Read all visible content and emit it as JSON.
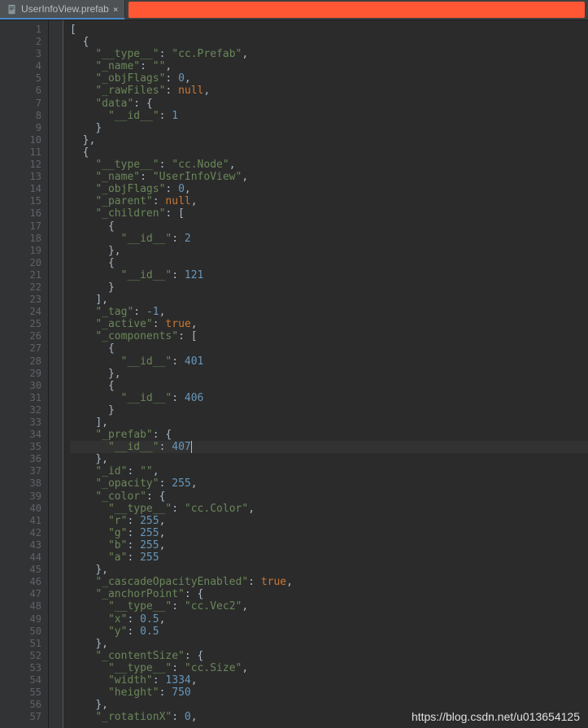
{
  "tab": {
    "filename": "UserInfoView.prefab",
    "close": "×"
  },
  "watermark": "https://blog.csdn.net/u013654125",
  "code": [
    {
      "n": 1,
      "t": "[",
      "i": 0
    },
    {
      "n": 2,
      "t": "{",
      "i": 1
    },
    {
      "n": 3,
      "i": 2,
      "tokens": [
        {
          "c": "s",
          "v": "\"__type__\""
        },
        {
          "c": "p",
          "v": ": "
        },
        {
          "c": "s",
          "v": "\"cc.Prefab\""
        },
        {
          "c": "p",
          "v": ","
        }
      ]
    },
    {
      "n": 4,
      "i": 2,
      "tokens": [
        {
          "c": "s",
          "v": "\"_name\""
        },
        {
          "c": "p",
          "v": ": "
        },
        {
          "c": "s",
          "v": "\"\""
        },
        {
          "c": "p",
          "v": ","
        }
      ]
    },
    {
      "n": 5,
      "i": 2,
      "tokens": [
        {
          "c": "s",
          "v": "\"_objFlags\""
        },
        {
          "c": "p",
          "v": ": "
        },
        {
          "c": "n",
          "v": "0"
        },
        {
          "c": "p",
          "v": ","
        }
      ]
    },
    {
      "n": 6,
      "i": 2,
      "tokens": [
        {
          "c": "s",
          "v": "\"_rawFiles\""
        },
        {
          "c": "p",
          "v": ": "
        },
        {
          "c": "b",
          "v": "null"
        },
        {
          "c": "p",
          "v": ","
        }
      ]
    },
    {
      "n": 7,
      "i": 2,
      "tokens": [
        {
          "c": "s",
          "v": "\"data\""
        },
        {
          "c": "p",
          "v": ": {"
        }
      ]
    },
    {
      "n": 8,
      "i": 3,
      "tokens": [
        {
          "c": "s",
          "v": "\"__id__\""
        },
        {
          "c": "p",
          "v": ": "
        },
        {
          "c": "n",
          "v": "1"
        }
      ]
    },
    {
      "n": 9,
      "t": "}",
      "i": 2
    },
    {
      "n": 10,
      "t": "},",
      "i": 1
    },
    {
      "n": 11,
      "t": "{",
      "i": 1
    },
    {
      "n": 12,
      "i": 2,
      "tokens": [
        {
          "c": "s",
          "v": "\"__type__\""
        },
        {
          "c": "p",
          "v": ": "
        },
        {
          "c": "s",
          "v": "\"cc.Node\""
        },
        {
          "c": "p",
          "v": ","
        }
      ]
    },
    {
      "n": 13,
      "i": 2,
      "tokens": [
        {
          "c": "s",
          "v": "\"_name\""
        },
        {
          "c": "p",
          "v": ": "
        },
        {
          "c": "s",
          "v": "\"UserInfoView\""
        },
        {
          "c": "p",
          "v": ","
        }
      ]
    },
    {
      "n": 14,
      "i": 2,
      "tokens": [
        {
          "c": "s",
          "v": "\"_objFlags\""
        },
        {
          "c": "p",
          "v": ": "
        },
        {
          "c": "n",
          "v": "0"
        },
        {
          "c": "p",
          "v": ","
        }
      ]
    },
    {
      "n": 15,
      "i": 2,
      "tokens": [
        {
          "c": "s",
          "v": "\"_parent\""
        },
        {
          "c": "p",
          "v": ": "
        },
        {
          "c": "b",
          "v": "null"
        },
        {
          "c": "p",
          "v": ","
        }
      ]
    },
    {
      "n": 16,
      "i": 2,
      "tokens": [
        {
          "c": "s",
          "v": "\"_children\""
        },
        {
          "c": "p",
          "v": ": ["
        }
      ]
    },
    {
      "n": 17,
      "t": "{",
      "i": 3
    },
    {
      "n": 18,
      "i": 4,
      "tokens": [
        {
          "c": "s",
          "v": "\"__id__\""
        },
        {
          "c": "p",
          "v": ": "
        },
        {
          "c": "n",
          "v": "2"
        }
      ]
    },
    {
      "n": 19,
      "t": "},",
      "i": 3
    },
    {
      "n": 20,
      "t": "{",
      "i": 3
    },
    {
      "n": 21,
      "i": 4,
      "tokens": [
        {
          "c": "s",
          "v": "\"__id__\""
        },
        {
          "c": "p",
          "v": ": "
        },
        {
          "c": "n",
          "v": "121"
        }
      ]
    },
    {
      "n": 22,
      "t": "}",
      "i": 3
    },
    {
      "n": 23,
      "t": "],",
      "i": 2
    },
    {
      "n": 24,
      "i": 2,
      "tokens": [
        {
          "c": "s",
          "v": "\"_tag\""
        },
        {
          "c": "p",
          "v": ": "
        },
        {
          "c": "n",
          "v": "-1"
        },
        {
          "c": "p",
          "v": ","
        }
      ]
    },
    {
      "n": 25,
      "i": 2,
      "tokens": [
        {
          "c": "s",
          "v": "\"_active\""
        },
        {
          "c": "p",
          "v": ": "
        },
        {
          "c": "b",
          "v": "true"
        },
        {
          "c": "p",
          "v": ","
        }
      ]
    },
    {
      "n": 26,
      "i": 2,
      "tokens": [
        {
          "c": "s",
          "v": "\"_components\""
        },
        {
          "c": "p",
          "v": ": ["
        }
      ]
    },
    {
      "n": 27,
      "t": "{",
      "i": 3
    },
    {
      "n": 28,
      "i": 4,
      "tokens": [
        {
          "c": "s",
          "v": "\"__id__\""
        },
        {
          "c": "p",
          "v": ": "
        },
        {
          "c": "n",
          "v": "401"
        }
      ]
    },
    {
      "n": 29,
      "t": "},",
      "i": 3
    },
    {
      "n": 30,
      "t": "{",
      "i": 3
    },
    {
      "n": 31,
      "i": 4,
      "tokens": [
        {
          "c": "s",
          "v": "\"__id__\""
        },
        {
          "c": "p",
          "v": ": "
        },
        {
          "c": "n",
          "v": "406"
        }
      ]
    },
    {
      "n": 32,
      "t": "}",
      "i": 3
    },
    {
      "n": 33,
      "t": "],",
      "i": 2
    },
    {
      "n": 34,
      "i": 2,
      "tokens": [
        {
          "c": "s",
          "v": "\"_prefab\""
        },
        {
          "c": "p",
          "v": ": {"
        }
      ]
    },
    {
      "n": 35,
      "i": 3,
      "hl": true,
      "cursor": true,
      "tokens": [
        {
          "c": "s",
          "v": "\"__id__\""
        },
        {
          "c": "p",
          "v": ": "
        },
        {
          "c": "n",
          "v": "407"
        }
      ]
    },
    {
      "n": 36,
      "t": "},",
      "i": 2
    },
    {
      "n": 37,
      "i": 2,
      "tokens": [
        {
          "c": "s",
          "v": "\"_id\""
        },
        {
          "c": "p",
          "v": ": "
        },
        {
          "c": "s",
          "v": "\"\""
        },
        {
          "c": "p",
          "v": ","
        }
      ]
    },
    {
      "n": 38,
      "i": 2,
      "tokens": [
        {
          "c": "s",
          "v": "\"_opacity\""
        },
        {
          "c": "p",
          "v": ": "
        },
        {
          "c": "n",
          "v": "255"
        },
        {
          "c": "p",
          "v": ","
        }
      ]
    },
    {
      "n": 39,
      "i": 2,
      "tokens": [
        {
          "c": "s",
          "v": "\"_color\""
        },
        {
          "c": "p",
          "v": ": {"
        }
      ]
    },
    {
      "n": 40,
      "i": 3,
      "tokens": [
        {
          "c": "s",
          "v": "\"__type__\""
        },
        {
          "c": "p",
          "v": ": "
        },
        {
          "c": "s",
          "v": "\"cc.Color\""
        },
        {
          "c": "p",
          "v": ","
        }
      ]
    },
    {
      "n": 41,
      "i": 3,
      "tokens": [
        {
          "c": "s",
          "v": "\"r\""
        },
        {
          "c": "p",
          "v": ": "
        },
        {
          "c": "n",
          "v": "255"
        },
        {
          "c": "p",
          "v": ","
        }
      ]
    },
    {
      "n": 42,
      "i": 3,
      "tokens": [
        {
          "c": "s",
          "v": "\"g\""
        },
        {
          "c": "p",
          "v": ": "
        },
        {
          "c": "n",
          "v": "255"
        },
        {
          "c": "p",
          "v": ","
        }
      ]
    },
    {
      "n": 43,
      "i": 3,
      "tokens": [
        {
          "c": "s",
          "v": "\"b\""
        },
        {
          "c": "p",
          "v": ": "
        },
        {
          "c": "n",
          "v": "255"
        },
        {
          "c": "p",
          "v": ","
        }
      ]
    },
    {
      "n": 44,
      "i": 3,
      "tokens": [
        {
          "c": "s",
          "v": "\"a\""
        },
        {
          "c": "p",
          "v": ": "
        },
        {
          "c": "n",
          "v": "255"
        }
      ]
    },
    {
      "n": 45,
      "t": "},",
      "i": 2
    },
    {
      "n": 46,
      "i": 2,
      "tokens": [
        {
          "c": "s",
          "v": "\"_cascadeOpacityEnabled\""
        },
        {
          "c": "p",
          "v": ": "
        },
        {
          "c": "b",
          "v": "true"
        },
        {
          "c": "p",
          "v": ","
        }
      ]
    },
    {
      "n": 47,
      "i": 2,
      "tokens": [
        {
          "c": "s",
          "v": "\"_anchorPoint\""
        },
        {
          "c": "p",
          "v": ": {"
        }
      ]
    },
    {
      "n": 48,
      "i": 3,
      "tokens": [
        {
          "c": "s",
          "v": "\"__type__\""
        },
        {
          "c": "p",
          "v": ": "
        },
        {
          "c": "s",
          "v": "\"cc.Vec2\""
        },
        {
          "c": "p",
          "v": ","
        }
      ]
    },
    {
      "n": 49,
      "i": 3,
      "tokens": [
        {
          "c": "s",
          "v": "\"x\""
        },
        {
          "c": "p",
          "v": ": "
        },
        {
          "c": "n",
          "v": "0.5"
        },
        {
          "c": "p",
          "v": ","
        }
      ]
    },
    {
      "n": 50,
      "i": 3,
      "tokens": [
        {
          "c": "s",
          "v": "\"y\""
        },
        {
          "c": "p",
          "v": ": "
        },
        {
          "c": "n",
          "v": "0.5"
        }
      ]
    },
    {
      "n": 51,
      "t": "},",
      "i": 2
    },
    {
      "n": 52,
      "i": 2,
      "tokens": [
        {
          "c": "s",
          "v": "\"_contentSize\""
        },
        {
          "c": "p",
          "v": ": {"
        }
      ]
    },
    {
      "n": 53,
      "i": 3,
      "tokens": [
        {
          "c": "s",
          "v": "\"__type__\""
        },
        {
          "c": "p",
          "v": ": "
        },
        {
          "c": "s",
          "v": "\"cc.Size\""
        },
        {
          "c": "p",
          "v": ","
        }
      ]
    },
    {
      "n": 54,
      "i": 3,
      "tokens": [
        {
          "c": "s",
          "v": "\"width\""
        },
        {
          "c": "p",
          "v": ": "
        },
        {
          "c": "n",
          "v": "1334"
        },
        {
          "c": "p",
          "v": ","
        }
      ]
    },
    {
      "n": 55,
      "i": 3,
      "tokens": [
        {
          "c": "s",
          "v": "\"height\""
        },
        {
          "c": "p",
          "v": ": "
        },
        {
          "c": "n",
          "v": "750"
        }
      ]
    },
    {
      "n": 56,
      "t": "},",
      "i": 2
    },
    {
      "n": 57,
      "i": 2,
      "tokens": [
        {
          "c": "s",
          "v": "\"_rotationX\""
        },
        {
          "c": "p",
          "v": ": "
        },
        {
          "c": "n",
          "v": "0"
        },
        {
          "c": "p",
          "v": ","
        }
      ]
    }
  ]
}
